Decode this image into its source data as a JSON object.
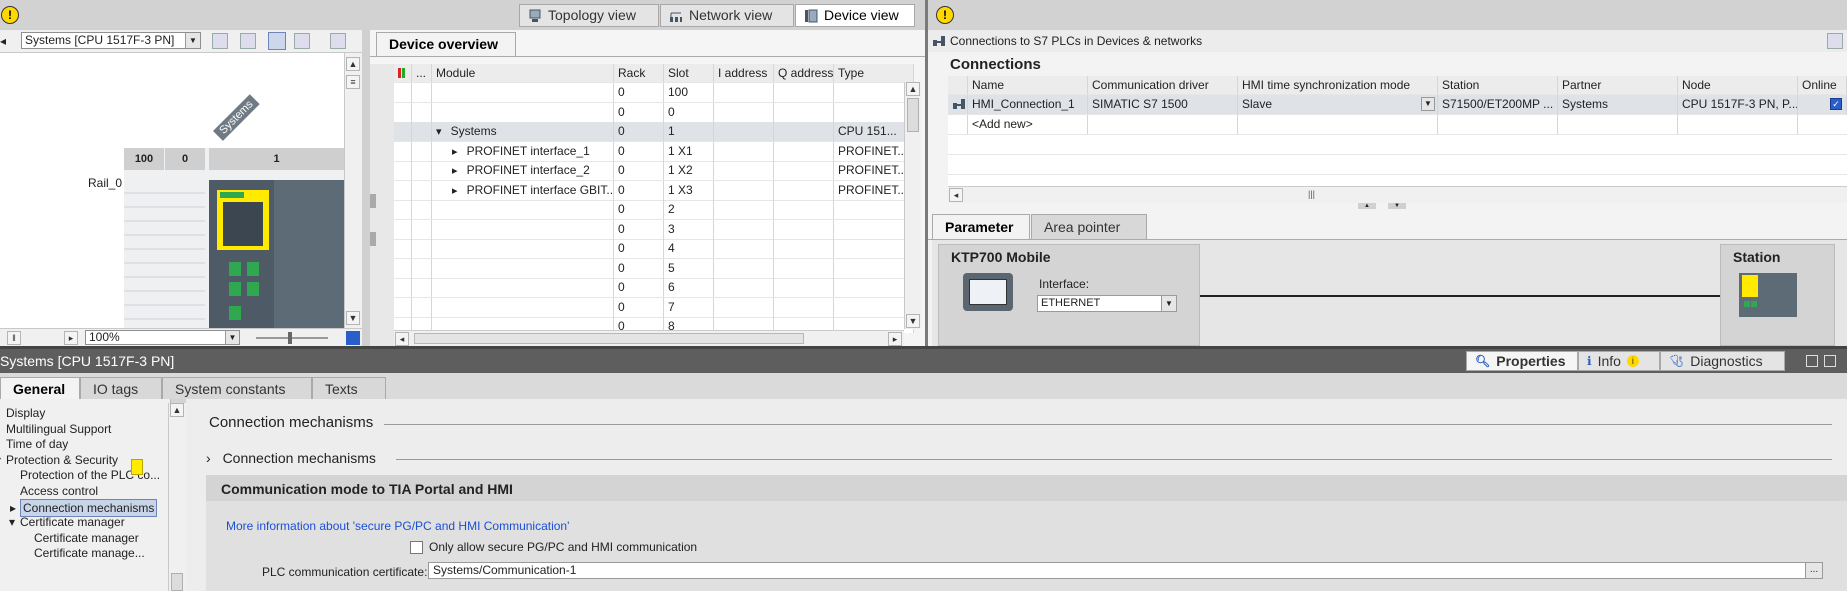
{
  "views": {
    "topology_label": "Topology view",
    "network_label": "Network view",
    "device_label": "Device view"
  },
  "device_toolbar": {
    "device_select": "Systems [CPU 1517F-3 PN]",
    "zoom_value": "100%"
  },
  "rack": {
    "station_label": "Systems",
    "rail_label": "Rail_0",
    "slot_headers": [
      "100",
      "0",
      "1"
    ]
  },
  "device_overview": {
    "tab_label": "Device overview",
    "columns": [
      "...",
      "Module",
      "Rack",
      "Slot",
      "I address",
      "Q address",
      "Type"
    ],
    "rows": [
      {
        "module": "",
        "rack": "0",
        "slot": "100",
        "type": ""
      },
      {
        "module": "",
        "rack": "0",
        "slot": "0",
        "type": ""
      },
      {
        "module": "Systems",
        "rack": "0",
        "slot": "1",
        "type": "CPU 151..."
      },
      {
        "module": "PROFINET interface_1",
        "rack": "0",
        "slot": "1 X1",
        "type": "PROFINET..."
      },
      {
        "module": "PROFINET interface_2",
        "rack": "0",
        "slot": "1 X2",
        "type": "PROFINET..."
      },
      {
        "module": "PROFINET interface GBIT...",
        "rack": "0",
        "slot": "1 X3",
        "type": "PROFINET..."
      },
      {
        "module": "",
        "rack": "0",
        "slot": "2",
        "type": ""
      },
      {
        "module": "",
        "rack": "0",
        "slot": "3",
        "type": ""
      },
      {
        "module": "",
        "rack": "0",
        "slot": "4",
        "type": ""
      },
      {
        "module": "",
        "rack": "0",
        "slot": "5",
        "type": ""
      },
      {
        "module": "",
        "rack": "0",
        "slot": "6",
        "type": ""
      },
      {
        "module": "",
        "rack": "0",
        "slot": "7",
        "type": ""
      },
      {
        "module": "",
        "rack": "0",
        "slot": "8",
        "type": ""
      }
    ]
  },
  "connections": {
    "window_title": "Connections to S7 PLCs in Devices & networks",
    "heading": "Connections",
    "columns": [
      "Name",
      "Communication driver",
      "HMI time synchronization mode",
      "Station",
      "Partner",
      "Node",
      "Online"
    ],
    "rows": [
      {
        "name": "HMI_Connection_1",
        "driver": "SIMATIC S7 1500",
        "sync": "Slave",
        "station": "S71500/ET200MP ...",
        "partner": "Systems",
        "node": "CPU 1517F-3 PN, P..."
      }
    ],
    "add_new": "<Add new>"
  },
  "params": {
    "tab_parameter": "Parameter",
    "tab_area": "Area pointer",
    "device_name": "KTP700 Mobile",
    "interface_label": "Interface:",
    "interface_value": "ETHERNET",
    "station_label": "Station"
  },
  "properties": {
    "title": "Systems [CPU 1517F-3 PN]",
    "tab_properties": "Properties",
    "tab_info": "Info",
    "tab_diagnostics": "Diagnostics",
    "tabs": [
      "General",
      "IO tags",
      "System constants",
      "Texts"
    ],
    "nav": [
      {
        "label": "Display",
        "indent": 0,
        "arrow": ""
      },
      {
        "label": "Multilingual Support",
        "indent": 0,
        "arrow": ""
      },
      {
        "label": "Time of day",
        "indent": 0,
        "arrow": ""
      },
      {
        "label": "Protection & Security",
        "indent": 0,
        "arrow": "open"
      },
      {
        "label": "Protection of the PLC co...",
        "indent": 1,
        "arrow": ""
      },
      {
        "label": "Access control",
        "indent": 1,
        "arrow": ""
      },
      {
        "label": "Connection mechanisms",
        "indent": 1,
        "arrow": "closed"
      },
      {
        "label": "Certificate manager",
        "indent": 1,
        "arrow": "open"
      },
      {
        "label": "Certificate manager",
        "indent": 2,
        "arrow": ""
      },
      {
        "label": "Certificate manage...",
        "indent": 2,
        "arrow": ""
      }
    ],
    "section_title": "Connection mechanisms",
    "subsection_title": "Connection mechanisms",
    "group_title": "Communication mode to TIA Portal and HMI",
    "info_link": "More information about 'secure PG/PC and HMI Communication'",
    "checkbox_label": "Only allow secure PG/PC and HMI communication",
    "cert_label": "PLC communication certificate:",
    "cert_value": "Systems/Communication-1",
    "browse_label": "..."
  },
  "colors": {
    "accent_blue": "#1a4fd6",
    "warning_yellow": "#ffd800",
    "siemens_green": "#2fa84f"
  }
}
